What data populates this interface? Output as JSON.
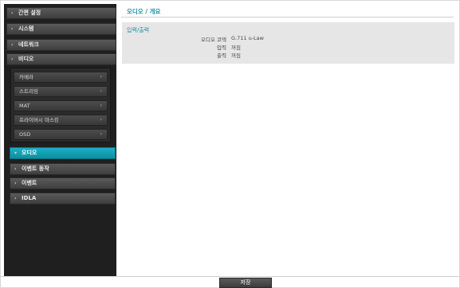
{
  "sidebar": {
    "items": [
      {
        "label": "간편 설정",
        "arrow": "›"
      },
      {
        "label": "시스템",
        "arrow": "›"
      },
      {
        "label": "네트워크",
        "arrow": "›"
      },
      {
        "label": "비디오",
        "arrow": "›"
      },
      {
        "label": "오디오",
        "arrow": "▾"
      },
      {
        "label": "이벤트 동작",
        "arrow": "›"
      },
      {
        "label": "이벤트",
        "arrow": "›"
      },
      {
        "label": "IDLA",
        "arrow": "›"
      }
    ],
    "video_submenu": [
      {
        "label": "카메라",
        "arrow": "›"
      },
      {
        "label": "스트리밍",
        "arrow": "›"
      },
      {
        "label": "MAT",
        "arrow": "›"
      },
      {
        "label": "프라이버시 마스킹",
        "arrow": "›"
      },
      {
        "label": "OSD",
        "arrow": "›"
      }
    ],
    "active_color": "#15a2b6"
  },
  "content": {
    "breadcrumb": "오디오 / 개요",
    "panel": {
      "title": "입력/출력",
      "rows": [
        {
          "label": "오디오 코덱",
          "value": "G.711 u-Law"
        },
        {
          "label": "입력",
          "value": "꺼짐"
        },
        {
          "label": "출력",
          "value": "꺼짐"
        }
      ]
    }
  },
  "footer": {
    "save_label": "저장"
  }
}
